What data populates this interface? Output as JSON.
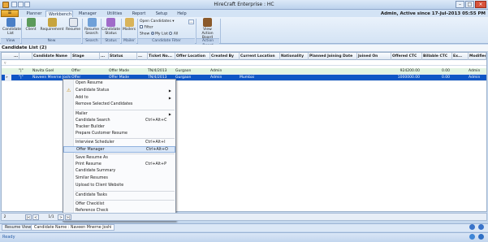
{
  "window": {
    "title": "HireCraft Enterprise : HC"
  },
  "ribbon_tabs": [
    {
      "label": "Planner"
    },
    {
      "label": "Workbench"
    },
    {
      "label": "Manager"
    },
    {
      "label": "Utilities"
    },
    {
      "label": "Report"
    },
    {
      "label": "Setup"
    },
    {
      "label": "Help"
    }
  ],
  "status_right": "Admin, Active since 17-Jul-2013 05:55 PM",
  "ribbon": {
    "candidate_list": "Candidate List",
    "client": "Client",
    "requirement": "Requirement",
    "resume": "Resume",
    "resume_search": "Resume Search",
    "candidate_status": "Candidate Status",
    "mailers": "Mailers",
    "open_candidates": "Open Candidates",
    "filter": "Filter",
    "show": "Show",
    "my_list": "My List",
    "all": "All",
    "view_action_board": "View Action Board",
    "groups": {
      "view": "View",
      "new": "New",
      "search": "Search",
      "status": "Status",
      "mailer": "Mailer",
      "candidate_filter": "Candidate Filter",
      "action_board": "Action Board"
    }
  },
  "candidate_list": {
    "title": "Candidate List  (2)",
    "columns": [
      "...",
      "Candidate Name",
      "Stage",
      "...",
      "Status",
      "...",
      "Ticket No...",
      "Offer Location",
      "Created By",
      "Current Location",
      "Nationality",
      "Planned Joining Date",
      "Joined On",
      "Offered CTC",
      "Billable CTC",
      "Ex...",
      "Modified"
    ],
    "rows": [
      {
        "marker": "",
        "flag": "\"|\"",
        "name": "Navita Goel",
        "stage": "Offer",
        "status": "Offer Made",
        "ticket": "TN/4/2013",
        "offer_location": "Gurgaon",
        "created_by": "Admin",
        "current_location": "",
        "offered_ctc": "924200.00",
        "billable_ctc": "0.00",
        "modified": "Admin"
      },
      {
        "marker": "»",
        "flag": "\"|\"",
        "name": "Naveen Mnerne Joshi",
        "stage": "Offer",
        "status": "Offer Made",
        "ticket": "TN/4/2013",
        "offer_location": "Gurgaon",
        "created_by": "Admin",
        "current_location": "Mumbai",
        "offered_ctc": "1000000.00",
        "billable_ctc": "0.00",
        "modified": "Admin"
      }
    ]
  },
  "context_menu": {
    "items": [
      {
        "label": "Open Resume"
      },
      {
        "label": "Candidate Status",
        "submenu": "true"
      },
      {
        "label": "Add to",
        "submenu": "true"
      },
      {
        "label": "Remove Selected Candidates"
      },
      {
        "label": "Mailer",
        "submenu": "true"
      },
      {
        "label": "Candidate Search",
        "shortcut": "Ctrl+Alt+C"
      },
      {
        "label": "Tracker Builder"
      },
      {
        "label": "Prepare Customer Resume"
      },
      {
        "label": "Interview Scheduler",
        "shortcut": "Ctrl+Alt+I"
      },
      {
        "label": "Offer Manager",
        "shortcut": "Ctrl+Alt+O"
      },
      {
        "label": "Save Resume As"
      },
      {
        "label": "Print Resume",
        "shortcut": "Ctrl+Alt+P"
      },
      {
        "label": "Candidate Summary"
      },
      {
        "label": "Similar Resumes"
      },
      {
        "label": "Upload to Client Website"
      },
      {
        "label": "Candidate Tasks"
      },
      {
        "label": "Offer Checklist"
      },
      {
        "label": "Reference Check"
      },
      {
        "label": "Report",
        "submenu": "true"
      }
    ],
    "arrow": "▶"
  },
  "pager": {
    "page": "2",
    "first": "|<",
    "prev": "<",
    "current": "1/1",
    "next": ">",
    "last": ">|"
  },
  "bottom_tabs": [
    {
      "label": "Resume View"
    },
    {
      "label": "Candidate Name : Naveen Mnerne Joshi"
    }
  ],
  "status_bar": {
    "ready": "Ready"
  },
  "colors": {
    "accent": "#0f56c5",
    "ribbon_bg": "#d4e3f4",
    "selected_row": "#0f56c5",
    "highlight_row": "#e2f4e2"
  }
}
